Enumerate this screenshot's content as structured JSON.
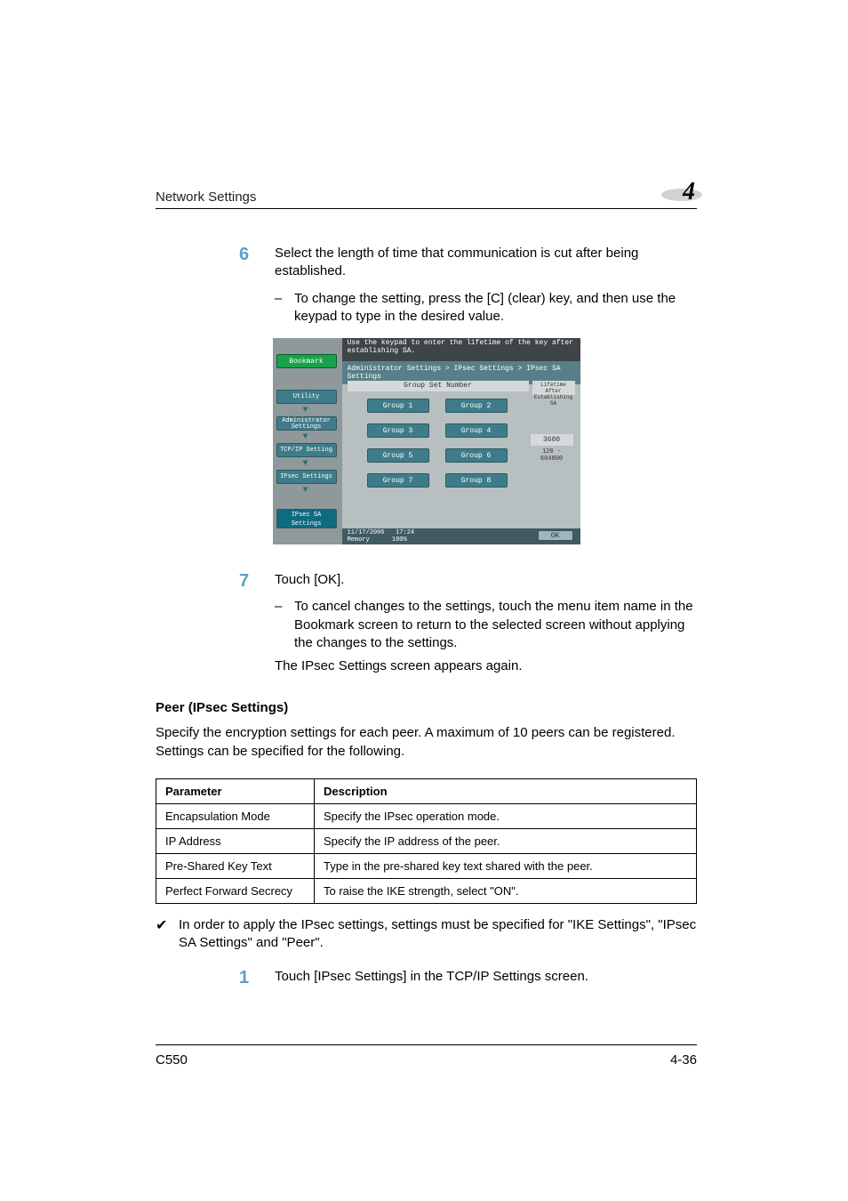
{
  "header": {
    "section": "Network Settings",
    "chapter": "4"
  },
  "step6": {
    "num": "6",
    "text": "Select the length of time that communication is cut after being established.",
    "sub": "To change the setting, press the [C] (clear) key, and then use the keypad to type in the desired value."
  },
  "screenshot": {
    "top_msg": "Use the keypad to enter the lifetime of the key after\nestablishing SA.",
    "bookmark": "Bookmark",
    "breadcrumb": "Administrator Settings > IPsec Settings > IPsec SA Settings",
    "sidebar": {
      "utility": "Utility",
      "admin": "Administrator\nSettings",
      "tcpip": "TCP/IP Setting",
      "ipsec": "IPsec Settings",
      "ipsecsa": "IPsec SA\nSettings"
    },
    "group_header": "Group Set Number",
    "right_header": "Lifetime After\nEstablishing SA",
    "groups": [
      "Group 1",
      "Group 2",
      "Group 3",
      "Group 4",
      "Group 5",
      "Group 6",
      "Group 7",
      "Group 8"
    ],
    "value": "3600",
    "range": "120 - 604800",
    "datetime": "11/17/2006   17:24\nMemory      100%",
    "ok": "OK"
  },
  "step7": {
    "num": "7",
    "text": "Touch [OK].",
    "sub": "To cancel changes to the settings, touch the menu item name in the Bookmark screen to return to the selected screen without applying the changes to the settings.",
    "after": "The IPsec Settings screen appears again."
  },
  "peer": {
    "heading": "Peer (IPsec Settings)",
    "intro": "Specify the encryption settings for each peer. A maximum of 10 peers can be registered. Settings can be specified for the following."
  },
  "table": {
    "head_param": "Parameter",
    "head_desc": "Description",
    "rows": [
      {
        "p": "Encapsulation Mode",
        "d": "Specify the IPsec operation mode."
      },
      {
        "p": "IP Address",
        "d": "Specify the IP address of the peer."
      },
      {
        "p": "Pre-Shared Key Text",
        "d": "Type in the pre-shared key text shared with the peer."
      },
      {
        "p": "Perfect Forward Secrecy",
        "d": "To raise the IKE strength, select \"ON\"."
      }
    ]
  },
  "check": {
    "text": "In order to apply the IPsec settings, settings must be specified for \"IKE Settings\", \"IPsec SA Settings\" and \"Peer\"."
  },
  "step1b": {
    "num": "1",
    "text": "Touch [IPsec Settings] in the TCP/IP Settings screen."
  },
  "footer": {
    "model": "C550",
    "page": "4-36"
  }
}
